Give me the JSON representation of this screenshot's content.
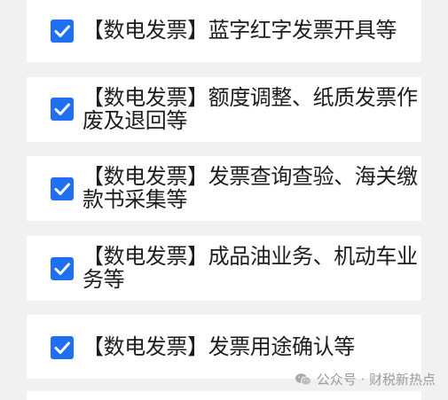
{
  "items": [
    {
      "label": "【数电发票】蓝字红字发票开具等",
      "checked": true
    },
    {
      "label": "【数电发票】额度调整、纸质发票作废及退回等",
      "checked": true
    },
    {
      "label": "【数电发票】发票查询查验、海关缴款书采集等",
      "checked": true
    },
    {
      "label": "【数电发票】成品油业务、机动车业务等",
      "checked": true
    },
    {
      "label": "【数电发票】发票用途确认等",
      "checked": true
    }
  ],
  "watermark": {
    "icon": "wechat-icon",
    "text": "公众号 · 财税新热点"
  },
  "colors": {
    "checkbox": "#1e6ff2",
    "card": "#ffffff",
    "background": "#f1f1f1",
    "text": "#1d1d1d"
  }
}
